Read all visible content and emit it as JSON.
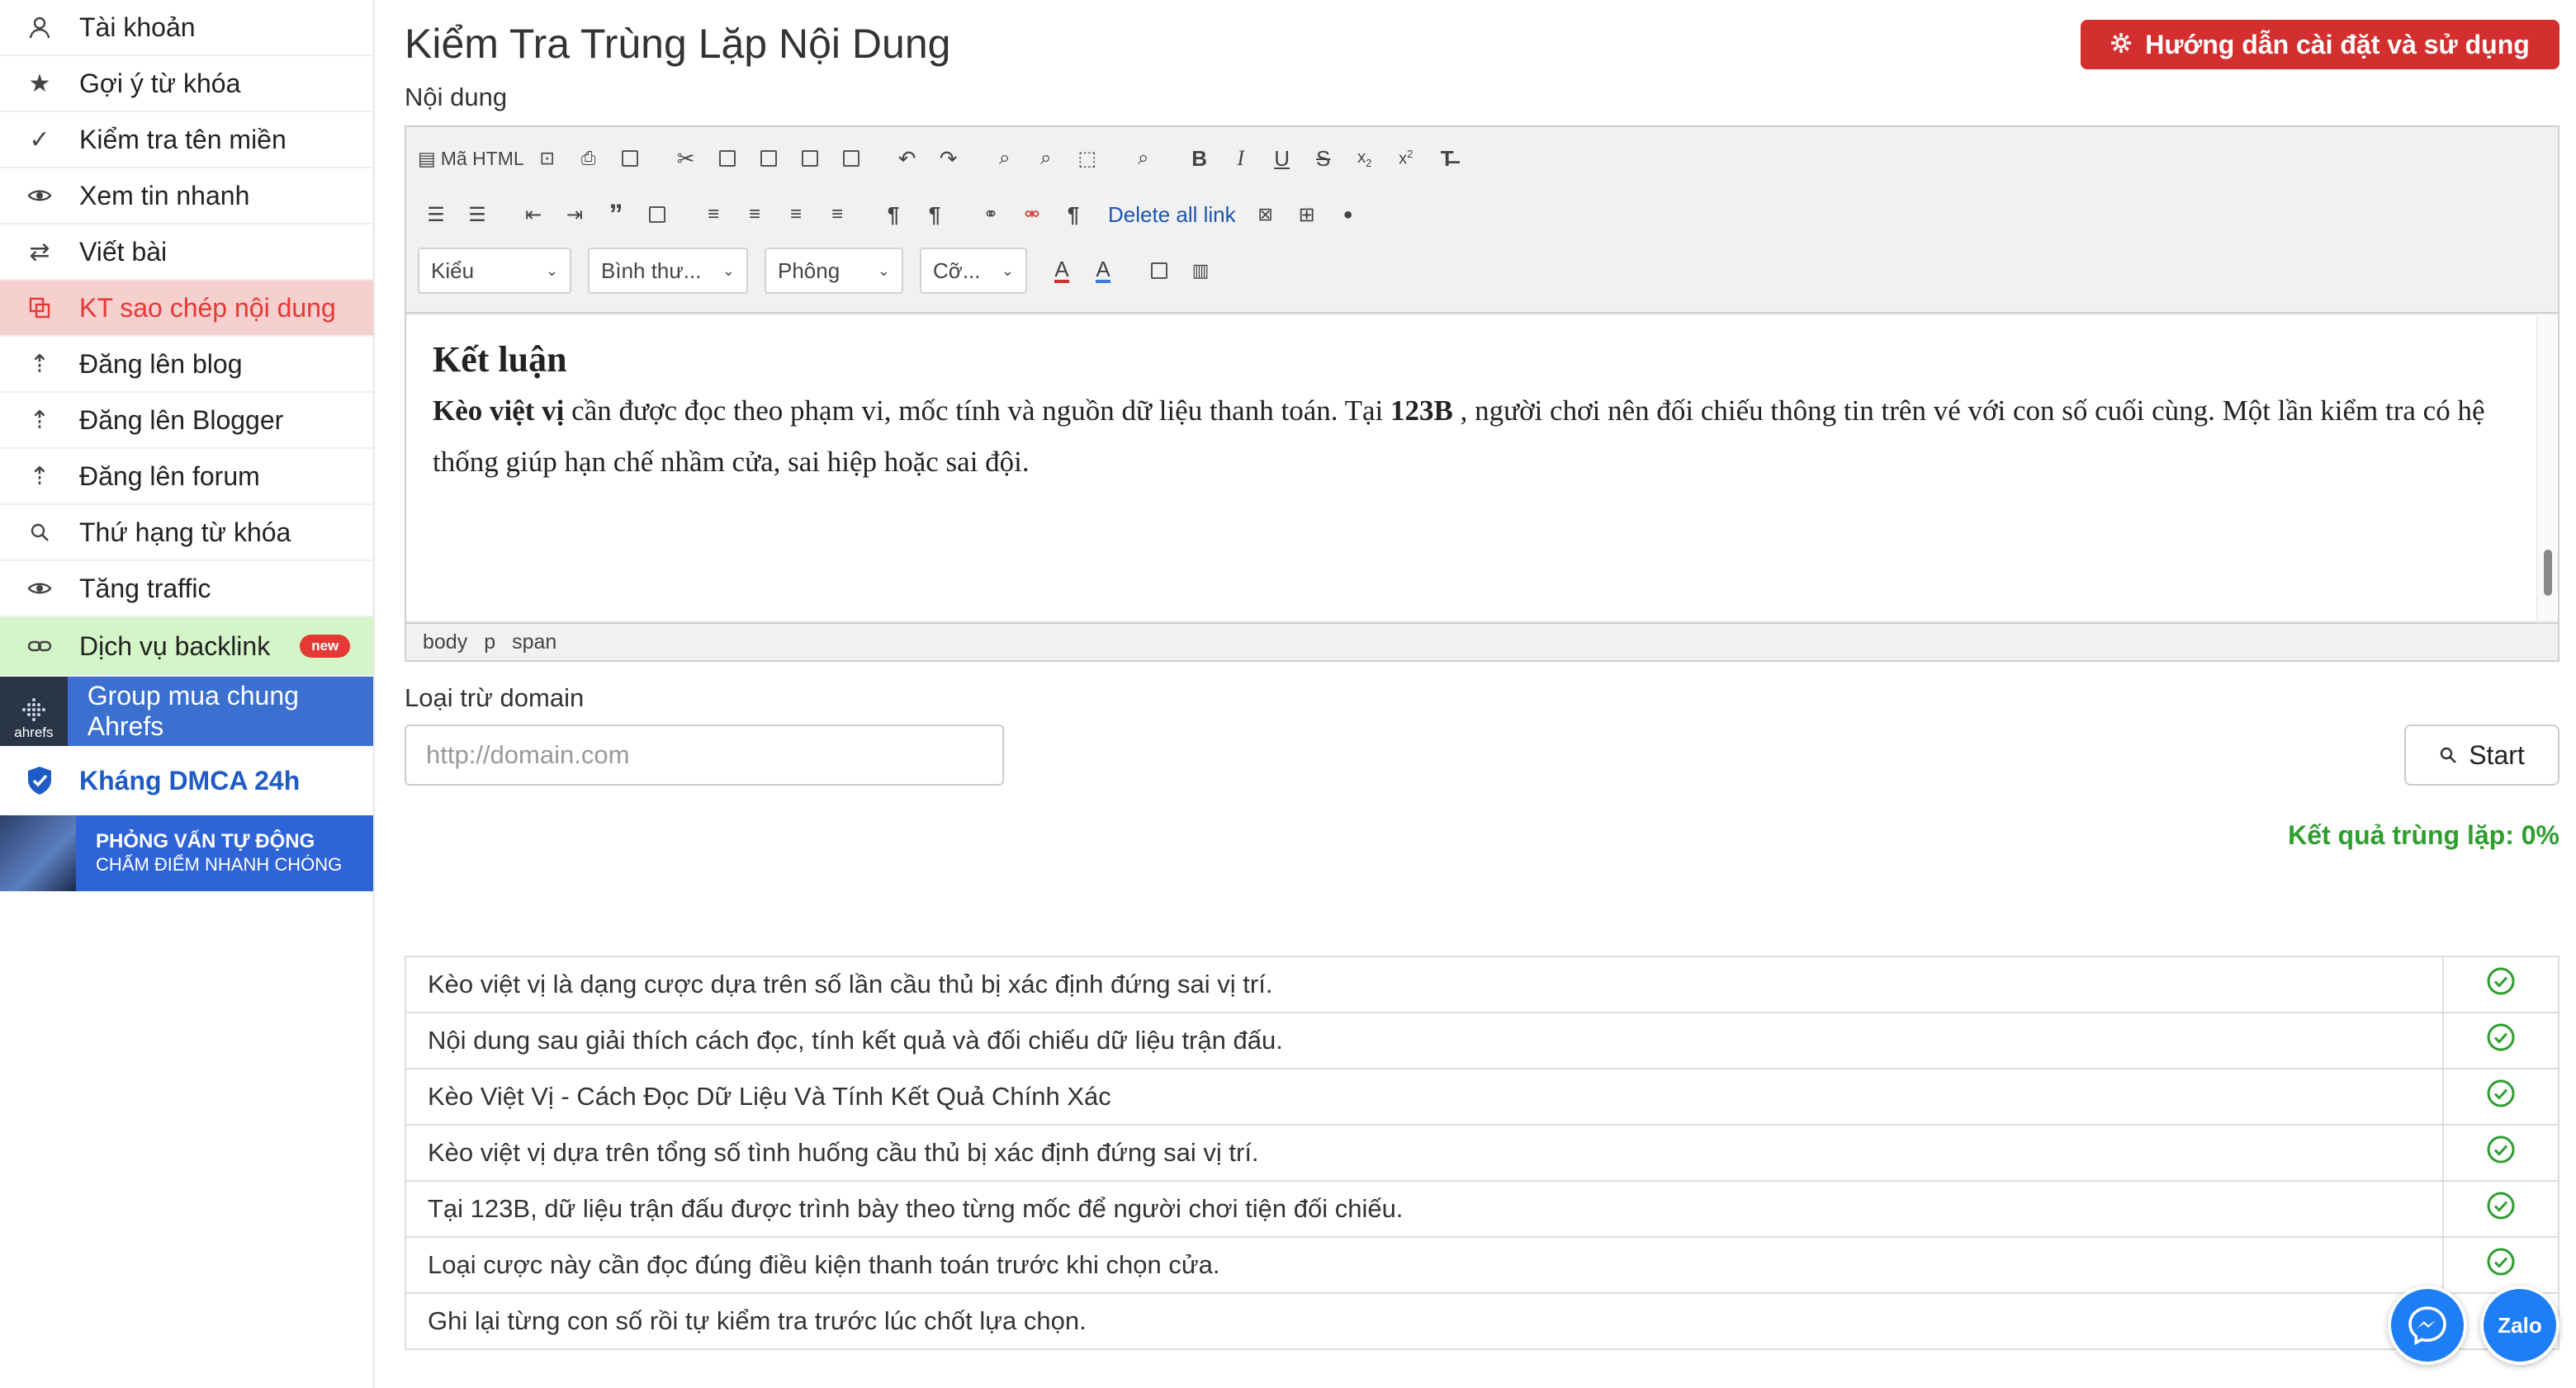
{
  "sidebar": {
    "items": [
      {
        "label": "Tài khoản",
        "icon": "user-icon"
      },
      {
        "label": "Gợi ý từ khóa",
        "icon": "star-icon"
      },
      {
        "label": "Kiểm tra tên miền",
        "icon": "check-icon"
      },
      {
        "label": "Xem tin nhanh",
        "icon": "eye-icon"
      },
      {
        "label": "Viết bài",
        "icon": "exchange-icon"
      },
      {
        "label": "KT sao chép nội dung",
        "icon": "copy-icon"
      },
      {
        "label": "Đăng lên blog",
        "icon": "upload-icon"
      },
      {
        "label": "Đăng lên Blogger",
        "icon": "upload-icon"
      },
      {
        "label": "Đăng lên forum",
        "icon": "upload-icon"
      },
      {
        "label": "Thứ hạng từ khóa",
        "icon": "search-icon"
      },
      {
        "label": "Tăng traffic",
        "icon": "eye-icon"
      }
    ],
    "backlink": {
      "label": "Dịch vụ backlink",
      "badge": "new"
    },
    "ahrefs": {
      "logo": "ahrefs",
      "label": "Group mua chung Ahrefs"
    },
    "dmca": {
      "label": "Kháng DMCA 24h"
    },
    "interview": {
      "line1": "PHỎNG VẤN TỰ ĐỘNG",
      "line2": "CHẤM ĐIỂM NHANH CHÓNG"
    }
  },
  "header": {
    "title": "Kiểm Tra Trùng Lặp Nội Dung",
    "guide_button": "Hướng dẫn cài đặt và sử dụng",
    "content_label": "Nội dung"
  },
  "toolbar": {
    "html_label": "Mã HTML",
    "delete_links": "Delete all link",
    "selects": {
      "style": "Kiểu",
      "format": "Bình thư...",
      "font": "Phông",
      "size": "Cỡ..."
    }
  },
  "editor": {
    "heading": "Kết luận",
    "p_bold1": "Kèo việt vị",
    "p_text1": " cần được đọc theo phạm vi, mốc tính và nguồn dữ liệu thanh toán. Tại ",
    "p_bold2": "123B",
    "p_text2": " , người chơi nên đối chiếu thông tin trên vé với con số cuối cùng. Một lần kiểm tra có hệ thống giúp hạn chế nhầm cửa, sai hiệp hoặc sai đội.",
    "path": [
      "body",
      "p",
      "span"
    ]
  },
  "exclude": {
    "label": "Loại trừ domain",
    "placeholder": "http://domain.com",
    "value": ""
  },
  "start_button": "Start",
  "result_text": "Kết quả trùng lặp: 0%",
  "results": [
    "Kèo việt vị là dạng cược dựa trên số lần cầu thủ bị xác định đứng sai vị trí.",
    "Nội dung sau giải thích cách đọc, tính kết quả và đối chiếu dữ liệu trận đấu.",
    "Kèo Việt Vị - Cách Đọc Dữ Liệu Và Tính Kết Quả Chính Xác",
    "Kèo việt vị dựa trên tổng số tình huống cầu thủ bị xác định đứng sai vị trí.",
    "Tại 123B, dữ liệu trận đấu được trình bày theo từng mốc để người chơi tiện đối chiếu.",
    "Loại cược này cần đọc đúng điều kiện thanh toán trước khi chọn cửa.",
    "Ghi lại từng con số rồi tự kiểm tra trước lúc chốt lựa chọn."
  ],
  "floating": {
    "zalo": "Zalo"
  },
  "colors": {
    "accent_red": "#d32f2f",
    "success_green": "#2e9e2e",
    "link_blue": "#1a56b0"
  }
}
